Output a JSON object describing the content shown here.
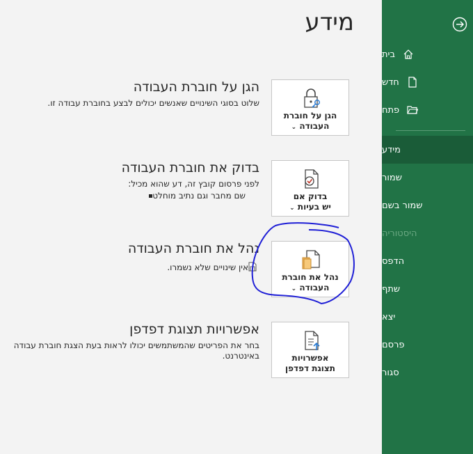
{
  "page": {
    "title": "מידע"
  },
  "sidebar": {
    "colors": {
      "background": "#217346",
      "selected": "#1a5c38"
    },
    "items": [
      {
        "label": "בית",
        "icon": "home-icon"
      },
      {
        "label": "חדש",
        "icon": "new-document-icon"
      },
      {
        "label": "פתח",
        "icon": "open-folder-icon"
      },
      {
        "label": "מידע",
        "selected": true
      },
      {
        "label": "שמור"
      },
      {
        "label": "שמור בשם"
      },
      {
        "label": "היסטוריה",
        "disabled": true
      },
      {
        "label": "הדפס"
      },
      {
        "label": "שתף"
      },
      {
        "label": "יצא"
      },
      {
        "label": "פרסם"
      },
      {
        "label": "סגור"
      }
    ]
  },
  "sections": [
    {
      "tile_line1": "הגן על חוברת",
      "tile_line2": "העבודה",
      "tile_icon": "lock-key-icon",
      "title": "הגן על חוברת העבודה",
      "desc": "שלוט בסוגי השינויים שאנשים יכולים לבצע בחוברת עבודה זו."
    },
    {
      "tile_line1": "בדוק אם",
      "tile_line2": "יש בעיות",
      "tile_icon": "document-check-icon",
      "title": "בדוק את חוברת העבודה",
      "desc": "לפני פרסום קובץ זה, דע שהוא מכיל:",
      "bullet": "שם מחבר וגם נתיב מוחלט"
    },
    {
      "tile_line1": "נהל את חוברת",
      "tile_line2": "העבודה",
      "tile_icon": "manage-workbook-icon",
      "title": "נהל את חוברת העבודה",
      "desc": "אין שינויים שלא נשמרו."
    },
    {
      "tile_line1": "אפשרויות",
      "tile_line2": "תצוגת דפדפן",
      "tile_icon": "browser-view-icon",
      "title": "אפשרויות תצוגת דפדפן",
      "desc": "בחר את הפריטים שהמשתמשים יכולו לראות בעת הצגת חוברת עבודה",
      "desc2": "באינטרנט."
    }
  ],
  "annotation": {
    "color": "#1f1fd6"
  }
}
